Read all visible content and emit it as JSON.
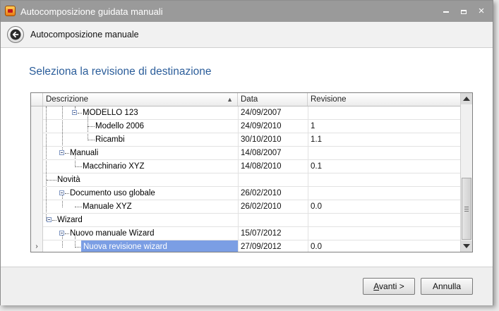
{
  "window": {
    "title": "Autocomposizione guidata manuali",
    "controls": {
      "minimize": "minimize-icon",
      "maximize": "maximize-icon",
      "close": "×"
    }
  },
  "header": {
    "back_icon": "back-arrow-icon",
    "title": "Autocomposizione manuale"
  },
  "section": {
    "title": "Seleziona la revisione di destinazione"
  },
  "grid": {
    "columns": {
      "description": "Descrizione",
      "date": "Data",
      "revision": "Revisione"
    },
    "sort_indicator": "▲",
    "current_row_indicator": "›",
    "rows": [
      {
        "label": "MODELLO 123",
        "date": "24/09/2007",
        "revision": ""
      },
      {
        "label": "Modello 2006",
        "date": "24/09/2010",
        "revision": "1"
      },
      {
        "label": "Ricambi",
        "date": "30/10/2010",
        "revision": "1.1"
      },
      {
        "label": "Manuali",
        "date": "14/08/2007",
        "revision": ""
      },
      {
        "label": "Macchinario XYZ",
        "date": "14/08/2010",
        "revision": "0.1"
      },
      {
        "label": "Novità",
        "date": "",
        "revision": ""
      },
      {
        "label": "Documento uso globale",
        "date": "26/02/2010",
        "revision": ""
      },
      {
        "label": "Manuale XYZ",
        "date": "26/02/2010",
        "revision": "0.0"
      },
      {
        "label": "Wizard",
        "date": "",
        "revision": ""
      },
      {
        "label": "Nuovo manuale Wizard",
        "date": "15/07/2012",
        "revision": ""
      },
      {
        "label": "Nuova revisione wizard",
        "date": "27/09/2012",
        "revision": "0.0"
      }
    ],
    "selection_color": "#7b9ee4"
  },
  "footer": {
    "next_button": {
      "label_prefix": "A",
      "label_rest": "vanti >"
    },
    "cancel_button": "Annulla"
  },
  "colors": {
    "title_bar": "#9a9a9a",
    "section_title": "#2b5d9a"
  }
}
